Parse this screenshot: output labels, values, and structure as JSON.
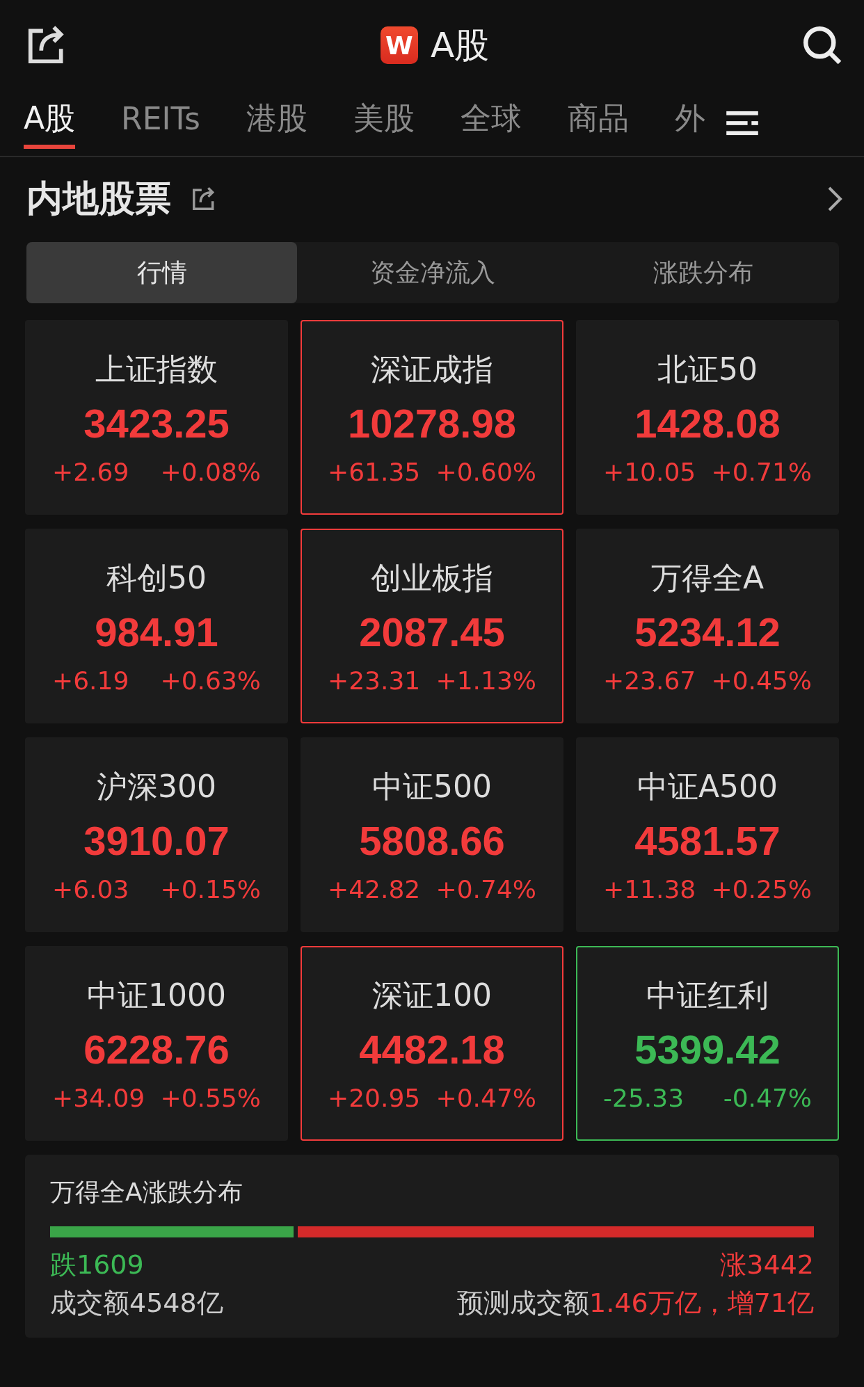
{
  "header": {
    "logo": "W",
    "title": "A股"
  },
  "tabs": [
    {
      "label": "A股",
      "selected": true
    },
    {
      "label": "REITs",
      "selected": false
    },
    {
      "label": "港股",
      "selected": false
    },
    {
      "label": "美股",
      "selected": false
    },
    {
      "label": "全球",
      "selected": false
    },
    {
      "label": "商品",
      "selected": false
    },
    {
      "label": "外",
      "selected": false
    }
  ],
  "section": {
    "title": "内地股票"
  },
  "segments": [
    {
      "label": "行情",
      "selected": true
    },
    {
      "label": "资金净流入",
      "selected": false
    },
    {
      "label": "涨跌分布",
      "selected": false
    }
  ],
  "indices": [
    {
      "name": "上证指数",
      "value": "3423.25",
      "change": "+2.69",
      "percent": "+0.08%",
      "color": "#f23b3b",
      "highlighted": false
    },
    {
      "name": "深证成指",
      "value": "10278.98",
      "change": "+61.35",
      "percent": "+0.60%",
      "color": "#f23b3b",
      "highlighted": true
    },
    {
      "name": "北证50",
      "value": "1428.08",
      "change": "+10.05",
      "percent": "+0.71%",
      "color": "#f23b3b",
      "highlighted": false
    },
    {
      "name": "科创50",
      "value": "984.91",
      "change": "+6.19",
      "percent": "+0.63%",
      "color": "#f23b3b",
      "highlighted": false
    },
    {
      "name": "创业板指",
      "value": "2087.45",
      "change": "+23.31",
      "percent": "+1.13%",
      "color": "#f23b3b",
      "highlighted": true
    },
    {
      "name": "万得全A",
      "value": "5234.12",
      "change": "+23.67",
      "percent": "+0.45%",
      "color": "#f23b3b",
      "highlighted": false
    },
    {
      "name": "沪深300",
      "value": "3910.07",
      "change": "+6.03",
      "percent": "+0.15%",
      "color": "#f23b3b",
      "highlighted": false
    },
    {
      "name": "中证500",
      "value": "5808.66",
      "change": "+42.82",
      "percent": "+0.74%",
      "color": "#f23b3b",
      "highlighted": false
    },
    {
      "name": "中证A500",
      "value": "4581.57",
      "change": "+11.38",
      "percent": "+0.25%",
      "color": "#f23b3b",
      "highlighted": false
    },
    {
      "name": "中证1000",
      "value": "6228.76",
      "change": "+34.09",
      "percent": "+0.55%",
      "color": "#f23b3b",
      "highlighted": false
    },
    {
      "name": "深证100",
      "value": "4482.18",
      "change": "+20.95",
      "percent": "+0.47%",
      "color": "#f23b3b",
      "highlighted": true
    },
    {
      "name": "中证红利",
      "value": "5399.42",
      "change": "-25.33",
      "percent": "-0.47%",
      "color": "#3cb955",
      "highlighted": true
    }
  ],
  "distribution": {
    "title": "万得全A涨跌分布",
    "level": 0.3186,
    "fall": "跌1609",
    "rise": "涨3442",
    "turnover": "成交额4548亿",
    "forecast_label": "预测成交额",
    "forecast_value": "1.46万亿，增71亿"
  }
}
